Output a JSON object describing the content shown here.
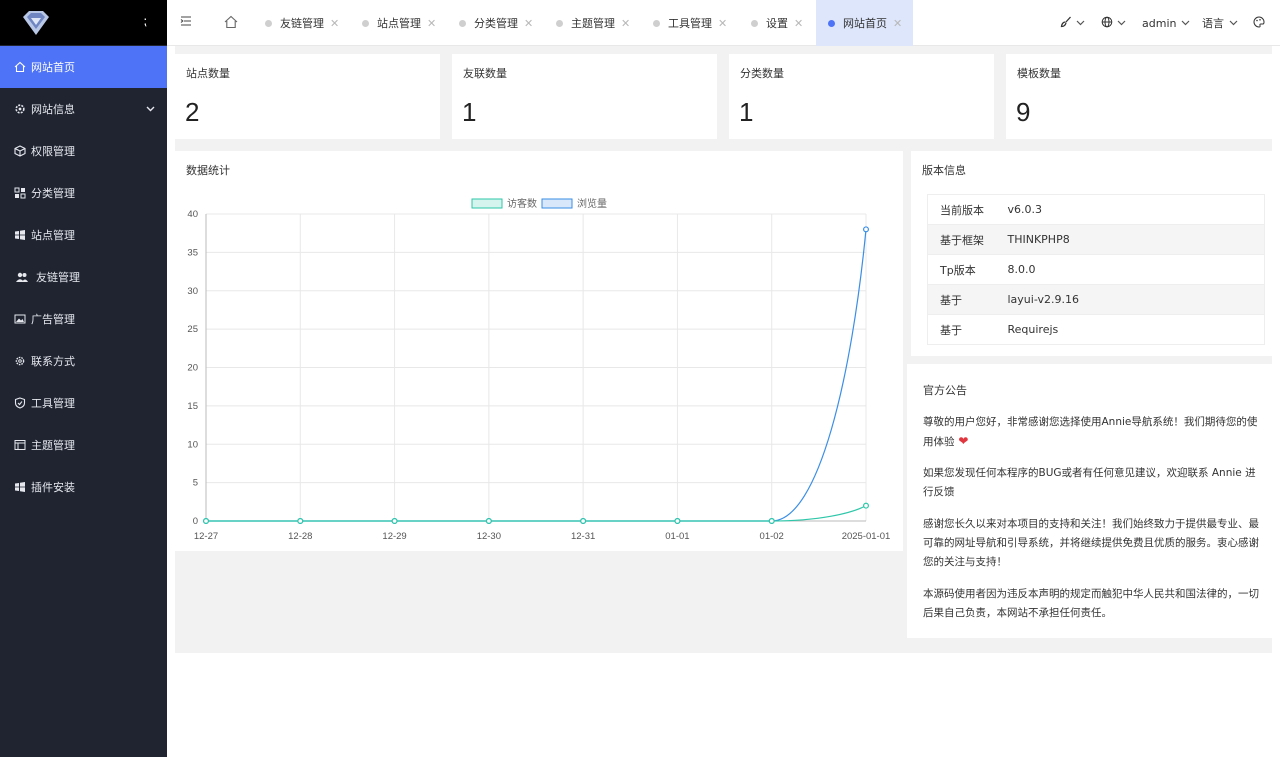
{
  "sidebar": {
    "items": [
      {
        "label": "网站首页",
        "icon": "home-icon"
      },
      {
        "label": "网站信息",
        "icon": "gear-icon"
      },
      {
        "label": "权限管理",
        "icon": "cube-icon"
      },
      {
        "label": "分类管理",
        "icon": "grid-icon"
      },
      {
        "label": "站点管理",
        "icon": "windows-icon"
      },
      {
        "label": "友链管理",
        "icon": "users-icon"
      },
      {
        "label": "广告管理",
        "icon": "image-icon"
      },
      {
        "label": "联系方式",
        "icon": "settings-icon"
      },
      {
        "label": "工具管理",
        "icon": "shield-icon"
      },
      {
        "label": "主题管理",
        "icon": "layout-icon"
      },
      {
        "label": "插件安装",
        "icon": "windows-icon"
      }
    ]
  },
  "tabs": [
    {
      "label": "友链管理"
    },
    {
      "label": "站点管理"
    },
    {
      "label": "分类管理"
    },
    {
      "label": "主题管理"
    },
    {
      "label": "工具管理"
    },
    {
      "label": "设置"
    },
    {
      "label": "网站首页"
    }
  ],
  "header": {
    "user": "admin",
    "language": "语言"
  },
  "stats": [
    {
      "label": "站点数量",
      "value": "2"
    },
    {
      "label": "友联数量",
      "value": "1"
    },
    {
      "label": "分类数量",
      "value": "1"
    },
    {
      "label": "模板数量",
      "value": "9"
    }
  ],
  "chart_panel": {
    "title": "数据统计"
  },
  "chart_data": {
    "type": "line",
    "categories": [
      "12-27",
      "12-28",
      "12-29",
      "12-30",
      "12-31",
      "01-01",
      "01-02",
      "2025-01-01"
    ],
    "series": [
      {
        "name": "访客数",
        "values": [
          0,
          0,
          0,
          0,
          0,
          0,
          0,
          2
        ],
        "color": "#2ec7a9"
      },
      {
        "name": "浏览量",
        "values": [
          0,
          0,
          0,
          0,
          0,
          0,
          0,
          38
        ],
        "color": "#3a8ee6"
      }
    ],
    "ylim": [
      0,
      40
    ],
    "yticks": [
      0,
      5,
      10,
      15,
      20,
      25,
      30,
      35,
      40
    ],
    "grid": true,
    "legend": "top-center"
  },
  "version": {
    "title": "版本信息",
    "rows": [
      {
        "k": "当前版本",
        "v": "v6.0.3"
      },
      {
        "k": "基于框架",
        "v": "THINKPHP8"
      },
      {
        "k": "Tp版本",
        "v": "8.0.0"
      },
      {
        "k": "基于",
        "v": "layui-v2.9.16"
      },
      {
        "k": "基于",
        "v": "Requirejs"
      }
    ]
  },
  "notice": {
    "title": "官方公告",
    "p1": "尊敬的用户您好，非常感谢您选择使用Annie导航系统！我们期待您的使用体验",
    "p2": "如果您发现任何本程序的BUG或者有任何意见建议，欢迎联系 Annie 进行反馈",
    "p3": "感谢您长久以来对本项目的支持和关注！我们始终致力于提供最专业、最可靠的网址导航和引导系统，并将继续提供免费且优质的服务。衷心感谢您的关注与支持！",
    "p4": "本源码使用者因为违反本声明的规定而触犯中华人民共和国法律的，一切后果自己负责，本网站不承担任何责任。"
  }
}
